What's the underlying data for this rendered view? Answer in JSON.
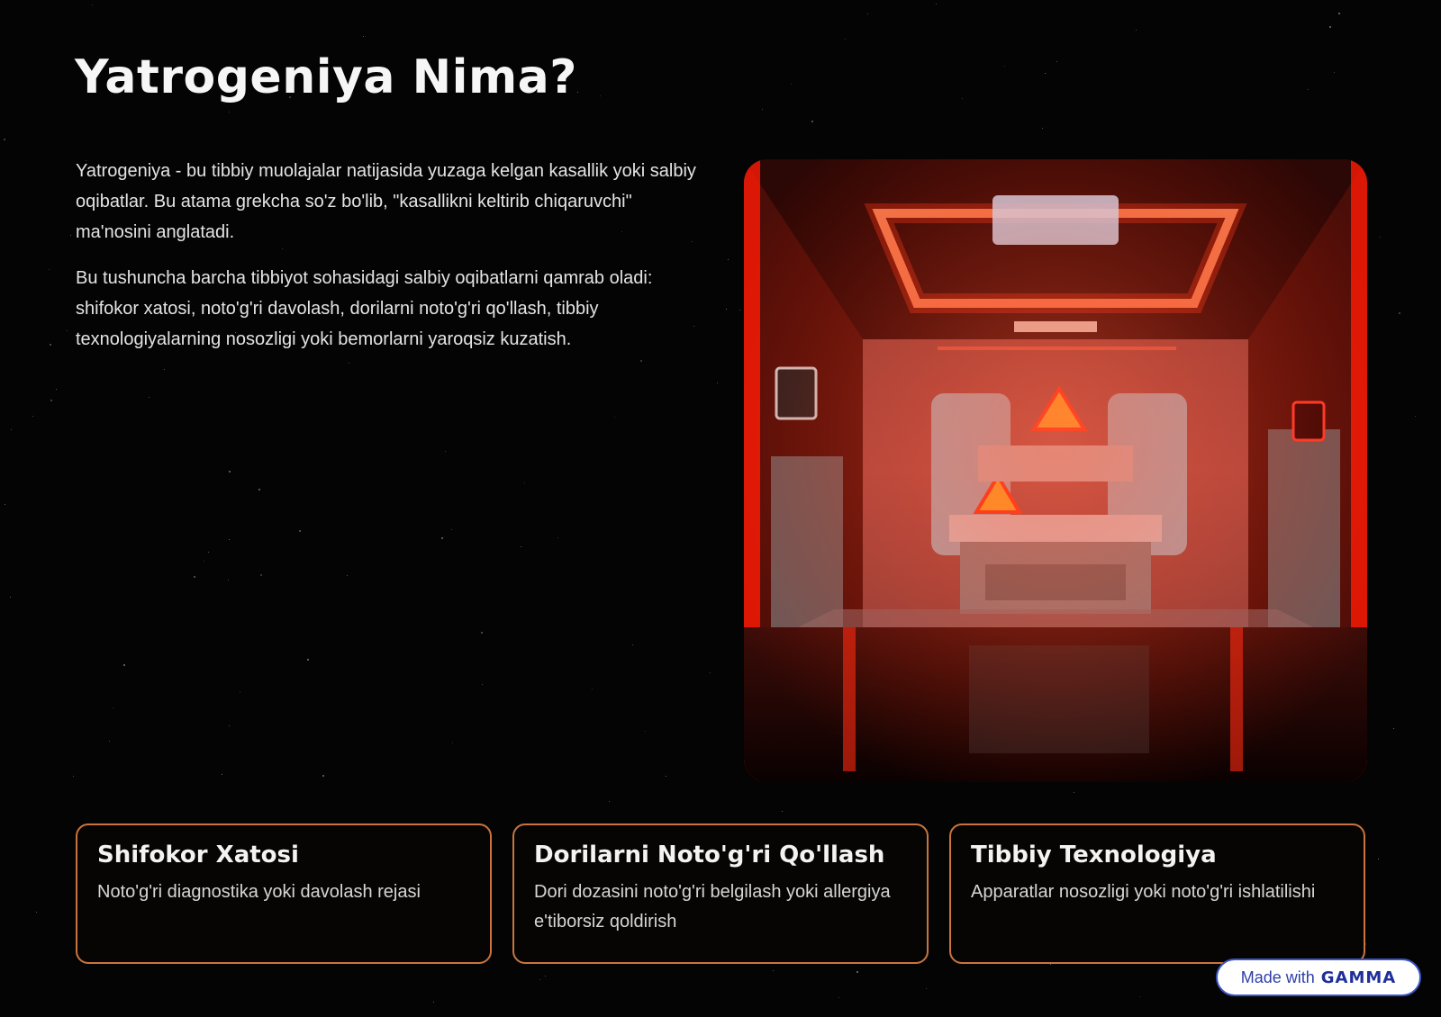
{
  "page": {
    "title": "Yatrogeniya Nima?",
    "paragraphs": [
      "Yatrogeniya - bu tibbiy muolajalar natijasida yuzaga kelgan kasallik yoki salbiy oqibatlar. Bu atama grekcha so'z bo'lib, \"kasallikni keltirib chiqaruvchi\" ma'nosini anglatadi.",
      "Bu tushuncha barcha tibbiyot sohasidagi salbiy oqibatlarni qamrab oladi: shifokor xatosi, noto'g'ri davolash, dorilarni noto'g'ri qo'llash, tibbiy texnologiyalarning nosozligi yoki bemorlarni yaroqsiz kuzatish."
    ]
  },
  "cards": [
    {
      "title": "Shifokor Xatosi",
      "text": "Noto'g'ri diagnostika yoki davolash rejasi"
    },
    {
      "title": "Dorilarni Noto'g'ri Qo'llash",
      "text": "Dori dozasini noto'g'ri belgilash yoki allergiya e'tiborsiz qoldirish"
    },
    {
      "title": "Tibbiy Texnologiya",
      "text": "Apparatlar nosozligi yoki noto'g'ri ishlatilishi"
    }
  ],
  "badge": {
    "label": "Made with",
    "brand": "GAMMA"
  },
  "image": {
    "subject": "red-lit-hospital-room-with-warning-signs"
  },
  "colors": {
    "background": "#040404",
    "card_border": "#c9743e",
    "accent_red": "#ff2a10",
    "badge_text": "#2d3fa8"
  }
}
